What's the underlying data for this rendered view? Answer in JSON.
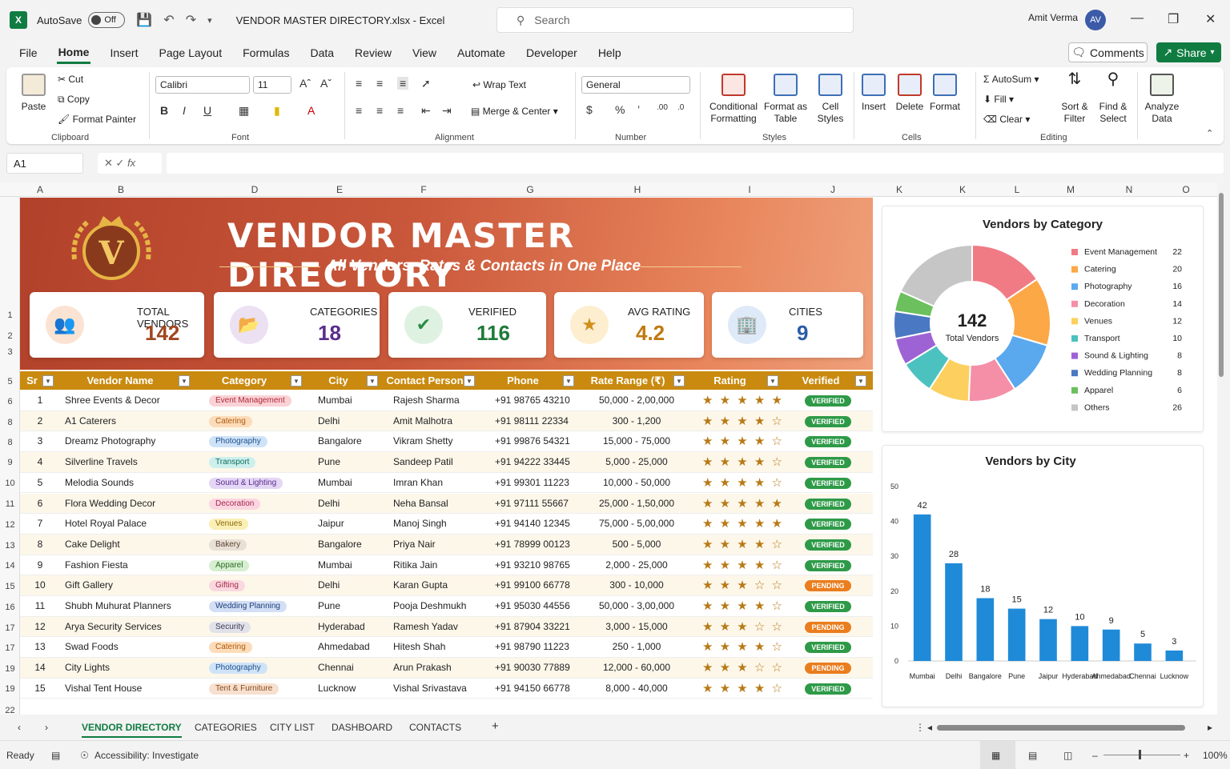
{
  "app": {
    "autosave_label": "AutoSave",
    "autosave_state": "Off",
    "doc_title": "VENDOR MASTER DIRECTORY.xlsx  -  Excel",
    "search_placeholder": "Search",
    "user_name": "Amit Verma",
    "user_initials": "AV"
  },
  "menu": [
    "File",
    "Home",
    "Insert",
    "Page Layout",
    "Formulas",
    "Data",
    "Review",
    "View",
    "Automate",
    "Developer",
    "Help"
  ],
  "menu_active": "Home",
  "buttons": {
    "comments": "Comments",
    "share": "Share"
  },
  "ribbon": {
    "clipboard": {
      "paste": "Paste",
      "cut": "Cut",
      "copy": "Copy",
      "format_painter": "Format Painter",
      "label": "Clipboard"
    },
    "font": {
      "name": "Calibri",
      "size": "11",
      "label": "Font"
    },
    "alignment": {
      "wrap": "Wrap Text",
      "merge": "Merge & Center",
      "label": "Alignment"
    },
    "number": {
      "format": "General",
      "label": "Number"
    },
    "styles": {
      "conditional": "Conditional Formatting",
      "format_table": "Format as Table",
      "cell_styles": "Cell Styles",
      "label": "Styles"
    },
    "cells": {
      "insert": "Insert",
      "delete": "Delete",
      "format": "Format",
      "label": "Cells"
    },
    "editing": {
      "autosum": "AutoSum",
      "fill": "Fill",
      "clear": "Clear",
      "sort": "Sort & Filter",
      "find": "Find & Select",
      "label": "Editing"
    },
    "analyze": "Analyze Data"
  },
  "formula_bar": {
    "name_box": "A1",
    "fx": "fx"
  },
  "columns": [
    "A",
    "B",
    "D",
    "E",
    "F",
    "G",
    "H",
    "I",
    "J",
    "K",
    "K",
    "L",
    "M",
    "N",
    "O"
  ],
  "row_numbers": [
    "1",
    "2",
    "3",
    "5",
    "6",
    "8",
    "8",
    "9",
    "10",
    "11",
    "12",
    "13",
    "14",
    "15",
    "16",
    "17",
    "17",
    "19",
    "19",
    "22"
  ],
  "banner": {
    "title": "VENDOR MASTER DIRECTORY",
    "subtitle": "All Vendors, Rates & Contacts in One Place",
    "logo_letter": "V"
  },
  "kpis": [
    {
      "label": "TOTAL VENDORS",
      "value": "142",
      "color": "#a0461f",
      "icon_bg": "#fbe3d3",
      "icon_color": "#c9673a",
      "icon": "users-icon",
      "glyph": "👥"
    },
    {
      "label": "CATEGORIES",
      "value": "18",
      "color": "#5b2d8c",
      "icon_bg": "#ece1f3",
      "icon_color": "#6a3aa0",
      "icon": "folder-icon",
      "glyph": "📂"
    },
    {
      "label": "VERIFIED",
      "value": "116",
      "color": "#1f7a3a",
      "icon_bg": "#dff2e2",
      "icon_color": "#2a8c44",
      "icon": "shield-check-icon",
      "glyph": "✔"
    },
    {
      "label": "AVG RATING",
      "value": "4.2",
      "color": "#c07a10",
      "icon_bg": "#fdeed0",
      "icon_color": "#d1901a",
      "icon": "star-icon",
      "glyph": "★"
    },
    {
      "label": "CITIES",
      "value": "9",
      "color": "#2a5ca8",
      "icon_bg": "#dfeaf8",
      "icon_color": "#2f6dc0",
      "icon": "building-icon",
      "glyph": "🏢"
    }
  ],
  "table": {
    "headers": [
      "Sr",
      "Vendor Name",
      "Category",
      "City",
      "Contact Person",
      "Phone",
      "Rate Range (₹)",
      "Rating",
      "Verified"
    ],
    "rows": [
      {
        "sr": "1",
        "name": "Shree Events & Decor",
        "category": "Event Management",
        "cat_bg": "#f9d2d6",
        "cat_fg": "#b3263a",
        "city": "Mumbai",
        "contact": "Rajesh Sharma",
        "phone": "+91 98765 43210",
        "rate": "50,000 - 2,00,000",
        "stars": "★ ★ ★ ★ ★",
        "verified": "VERIFIED"
      },
      {
        "sr": "2",
        "name": "A1 Caterers",
        "category": "Catering",
        "cat_bg": "#fcdcb9",
        "cat_fg": "#b05a0e",
        "city": "Delhi",
        "contact": "Amit Malhotra",
        "phone": "+91 98111 22334",
        "rate": "300 - 1,200",
        "stars": "★ ★ ★ ★ ☆",
        "verified": "VERIFIED"
      },
      {
        "sr": "3",
        "name": "Dreamz Photography",
        "category": "Photography",
        "cat_bg": "#cfe3f8",
        "cat_fg": "#1e4f8a",
        "city": "Bangalore",
        "contact": "Vikram Shetty",
        "phone": "+91 99876 54321",
        "rate": "15,000 - 75,000",
        "stars": "★ ★ ★ ★ ☆",
        "verified": "VERIFIED"
      },
      {
        "sr": "4",
        "name": "Silverline Travels",
        "category": "Transport",
        "cat_bg": "#cdf0ec",
        "cat_fg": "#0f6b62",
        "city": "Pune",
        "contact": "Sandeep Patil",
        "phone": "+91 94222 33445",
        "rate": "5,000 - 25,000",
        "stars": "★ ★ ★ ★ ☆",
        "verified": "VERIFIED"
      },
      {
        "sr": "5",
        "name": "Melodia Sounds",
        "category": "Sound & Lighting",
        "cat_bg": "#e4d6f5",
        "cat_fg": "#5a2c8f",
        "city": "Mumbai",
        "contact": "Imran Khan",
        "phone": "+91 99301 11223",
        "rate": "10,000 - 50,000",
        "stars": "★ ★ ★ ★ ☆",
        "verified": "VERIFIED"
      },
      {
        "sr": "6",
        "name": "Flora Wedding Decor",
        "category": "Decoration",
        "cat_bg": "#fbd6e0",
        "cat_fg": "#a62650",
        "city": "Delhi",
        "contact": "Neha Bansal",
        "phone": "+91 97111 55667",
        "rate": "25,000 - 1,50,000",
        "stars": "★ ★ ★ ★ ★",
        "verified": "VERIFIED"
      },
      {
        "sr": "7",
        "name": "Hotel Royal Palace",
        "category": "Venues",
        "cat_bg": "#fbefb5",
        "cat_fg": "#8a6a08",
        "city": "Jaipur",
        "contact": "Manoj Singh",
        "phone": "+91 94140 12345",
        "rate": "75,000 - 5,00,000",
        "stars": "★ ★ ★ ★ ★",
        "verified": "VERIFIED"
      },
      {
        "sr": "8",
        "name": "Cake Delight",
        "category": "Bakery",
        "cat_bg": "#e8dfd5",
        "cat_fg": "#5e4632",
        "city": "Bangalore",
        "contact": "Priya Nair",
        "phone": "+91 78999 00123",
        "rate": "500 - 5,000",
        "stars": "★ ★ ★ ★ ☆",
        "verified": "VERIFIED"
      },
      {
        "sr": "9",
        "name": "Fashion Fiesta",
        "category": "Apparel",
        "cat_bg": "#d5efd0",
        "cat_fg": "#2e6b22",
        "city": "Mumbai",
        "contact": "Ritika Jain",
        "phone": "+91 93210 98765",
        "rate": "2,000 - 25,000",
        "stars": "★ ★ ★ ★ ☆",
        "verified": "VERIFIED"
      },
      {
        "sr": "10",
        "name": "Gift Gallery",
        "category": "Gifting",
        "cat_bg": "#fbd8df",
        "cat_fg": "#9e2a45",
        "city": "Delhi",
        "contact": "Karan Gupta",
        "phone": "+91 99100 66778",
        "rate": "300 - 10,000",
        "stars": "★ ★ ★ ☆ ☆",
        "verified": "PENDING"
      },
      {
        "sr": "11",
        "name": "Shubh Muhurat Planners",
        "category": "Wedding Planning",
        "cat_bg": "#d3dff5",
        "cat_fg": "#1f3f7a",
        "city": "Pune",
        "contact": "Pooja Deshmukh",
        "phone": "+91 95030 44556",
        "rate": "50,000 - 3,00,000",
        "stars": "★ ★ ★ ★ ☆",
        "verified": "VERIFIED"
      },
      {
        "sr": "12",
        "name": "Arya Security Services",
        "category": "Security",
        "cat_bg": "#e1e1ea",
        "cat_fg": "#3c3c55",
        "city": "Hyderabad",
        "contact": "Ramesh Yadav",
        "phone": "+91 87904 33221",
        "rate": "3,000 - 15,000",
        "stars": "★ ★ ★ ☆ ☆",
        "verified": "PENDING"
      },
      {
        "sr": "13",
        "name": "Swad Foods",
        "category": "Catering",
        "cat_bg": "#fcdcb9",
        "cat_fg": "#b05a0e",
        "city": "Ahmedabad",
        "contact": "Hitesh Shah",
        "phone": "+91 98790 11223",
        "rate": "250 - 1,000",
        "stars": "★ ★ ★ ★ ☆",
        "verified": "VERIFIED"
      },
      {
        "sr": "14",
        "name": "City Lights",
        "category": "Photography",
        "cat_bg": "#cfe3f8",
        "cat_fg": "#1e4f8a",
        "city": "Chennai",
        "contact": "Arun Prakash",
        "phone": "+91 90030 77889",
        "rate": "12,000 - 60,000",
        "stars": "★ ★ ★ ☆ ☆",
        "verified": "PENDING"
      },
      {
        "sr": "15",
        "name": "Vishal Tent House",
        "category": "Tent & Furniture",
        "cat_bg": "#f7e0cf",
        "cat_fg": "#8a4a1a",
        "city": "Lucknow",
        "contact": "Vishal Srivastava",
        "phone": "+91 94150 66778",
        "rate": "8,000 - 40,000",
        "stars": "★ ★ ★ ★ ☆",
        "verified": "VERIFIED"
      }
    ],
    "status_colors": {
      "VERIFIED": "#2e9a48",
      "PENDING": "#ea7d1e"
    }
  },
  "chart_data": [
    {
      "type": "pie",
      "title": "Vendors by Category",
      "center_value": "142",
      "center_label": "Total Vendors",
      "categories": [
        "Event Management",
        "Catering",
        "Photography",
        "Decoration",
        "Venues",
        "Transport",
        "Sound & Lighting",
        "Wedding Planning",
        "Apparel",
        "Others"
      ],
      "values": [
        22,
        20,
        16,
        14,
        12,
        10,
        8,
        8,
        6,
        26
      ],
      "colors": [
        "#f07b85",
        "#fca847",
        "#5aa9ee",
        "#f58fa8",
        "#fccf5e",
        "#4cc2c0",
        "#9d63d4",
        "#4a78c2",
        "#6cc05d",
        "#c6c6c6"
      ],
      "legend": "right"
    },
    {
      "type": "bar",
      "title": "Vendors by City",
      "categories": [
        "Mumbai",
        "Delhi",
        "Bangalore",
        "Pune",
        "Jaipur",
        "Hyderabad",
        "Ahmedabad",
        "Chennai",
        "Lucknow"
      ],
      "values": [
        42,
        28,
        18,
        15,
        12,
        10,
        9,
        5,
        3
      ],
      "yticks": [
        "0",
        "10",
        "20",
        "30",
        "40",
        "50"
      ],
      "ylim": [
        0,
        50
      ],
      "color": "#1f8ad8"
    }
  ],
  "sheet_tabs": [
    "VENDOR DIRECTORY",
    "CATEGORIES",
    "CITY LIST",
    "DASHBOARD",
    "CONTACTS"
  ],
  "sheet_active": "VENDOR DIRECTORY",
  "status": {
    "ready": "Ready",
    "accessibility": "Accessibility: Investigate",
    "zoom": "100%"
  }
}
